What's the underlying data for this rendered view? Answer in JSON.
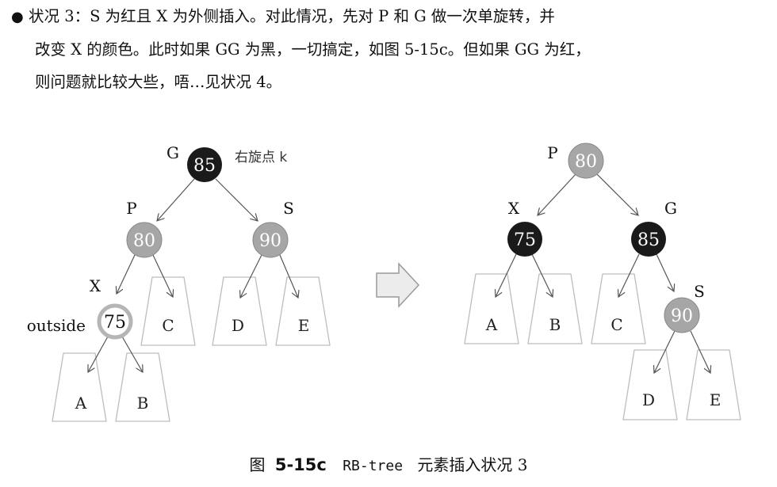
{
  "paragraph": {
    "bullet": "●",
    "line1": "状况 3：S 为红且 X 为外侧插入。对此情况，先对 P 和 G 做一次单旋转，并",
    "line2": "改变 X 的颜色。此时如果 GG 为黑，一切搞定，如图 5-15c。但如果 GG 为红，",
    "line3": "则问题就比较大些，唔…见状况 4。"
  },
  "left_tree": {
    "rotate_annotation": "右旋点 k",
    "outside_label": "outside",
    "nodes": {
      "G": {
        "label": "G",
        "value": "85"
      },
      "P": {
        "label": "P",
        "value": "80"
      },
      "S": {
        "label": "S",
        "value": "90"
      },
      "X": {
        "label": "X",
        "value": "75"
      }
    },
    "subtrees": {
      "A": "A",
      "B": "B",
      "C": "C",
      "D": "D",
      "E": "E"
    }
  },
  "right_tree": {
    "nodes": {
      "P": {
        "label": "P",
        "value": "80"
      },
      "X": {
        "label": "X",
        "value": "75"
      },
      "G": {
        "label": "G",
        "value": "85"
      },
      "S": {
        "label": "S",
        "value": "90"
      }
    },
    "subtrees": {
      "A": "A",
      "B": "B",
      "C": "C",
      "D": "D",
      "E": "E"
    }
  },
  "colors": {
    "black_node": "#1a1a1a",
    "red_node": "#a6a6a6",
    "subtree_stroke": "#bdbdbd",
    "arrow": "#555555"
  },
  "caption": {
    "prefix": "图",
    "number": "5-15c",
    "code": "RB-tree",
    "text": "元素插入状况 3"
  }
}
